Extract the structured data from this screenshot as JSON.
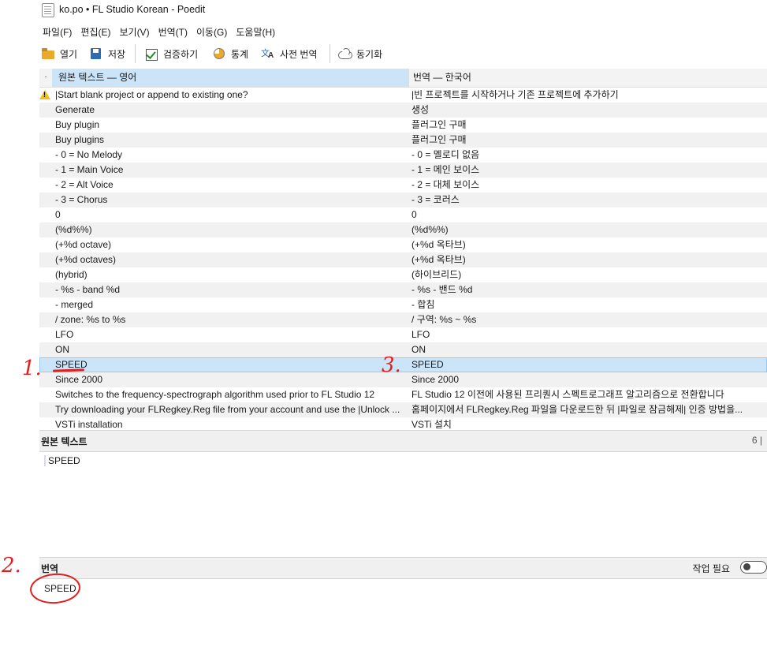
{
  "window": {
    "title": "ko.po • FL Studio Korean - Poedit"
  },
  "menu": [
    "파일(F)",
    "편집(E)",
    "보기(V)",
    "번역(T)",
    "이동(G)",
    "도움말(H)"
  ],
  "toolbar": {
    "open": "열기",
    "save": "저장",
    "validate": "검증하기",
    "stats": "통계",
    "dictionary": "사전 번역",
    "sync": "동기화"
  },
  "list": {
    "status_header": "·",
    "source_header": "원본 텍스트 — 영어",
    "translation_header": "번역 — 한국어",
    "rows": [
      {
        "source": "|Start blank project or append to existing one?",
        "translation": "|빈 프로젝트를 시작하거나 기존 프로젝트에 추가하기",
        "warning": true
      },
      {
        "source": "Generate",
        "translation": "생성"
      },
      {
        "source": "Buy plugin",
        "translation": "플러그인 구매"
      },
      {
        "source": "Buy plugins",
        "translation": "플러그인 구매"
      },
      {
        "source": "- 0 = No Melody",
        "translation": "- 0 = 멜로디 없음"
      },
      {
        "source": "- 1 = Main Voice",
        "translation": "- 1 = 메인 보이스"
      },
      {
        "source": "- 2 = Alt Voice",
        "translation": "- 2 = 대체 보이스"
      },
      {
        "source": "- 3 = Chorus",
        "translation": "- 3 = 코러스"
      },
      {
        "source": "0",
        "translation": "0"
      },
      {
        "source": "(%d%%)",
        "translation": "(%d%%)"
      },
      {
        "source": "(+%d octave)",
        "translation": "(+%d 옥타브)"
      },
      {
        "source": "(+%d octaves)",
        "translation": "(+%d 옥타브)"
      },
      {
        "source": "(hybrid)",
        "translation": "(하이브리드)"
      },
      {
        "source": "- %s - band %d",
        "translation": "- %s - 밴드 %d"
      },
      {
        "source": "- merged",
        "translation": "- 합침"
      },
      {
        "source": "/ zone: %s to %s",
        "translation": "/ 구역: %s ~ %s"
      },
      {
        "source": "LFO",
        "translation": "LFO"
      },
      {
        "source": "ON",
        "translation": "ON"
      },
      {
        "source": "SPEED",
        "translation": "SPEED",
        "selected": true
      },
      {
        "source": "Since 2000",
        "translation": "Since 2000"
      },
      {
        "source": "Switches to the frequency-spectrograph algorithm used prior to FL Studio 12",
        "translation": "FL Studio 12 이전에 사용된 프리퀀시 스펙트로그래프 알고리즘으로 전환합니다"
      },
      {
        "source": "Try downloading your FLRegkey.Reg file from your account and use the |Unlock ...",
        "translation": "홈페이지에서 FLRegkey.Reg 파일을 다운로드한 뒤 |파일로 잠금해제| 인증 방법을..."
      },
      {
        "source": "VSTi installation",
        "translation": "VSTi 설치"
      }
    ]
  },
  "source_panel": {
    "title": "원본 텍스트",
    "count": "6 |",
    "text": "SPEED"
  },
  "translation_panel": {
    "title": "번역",
    "needs_work_label": "작업 필요",
    "needs_work": false,
    "text": "SPEED"
  },
  "annotations": {
    "one": "1.",
    "two": "2.",
    "three": "3."
  },
  "colors": {
    "selection": "#cce4f7",
    "annotation": "#e02020",
    "warning": "#f2c019"
  }
}
